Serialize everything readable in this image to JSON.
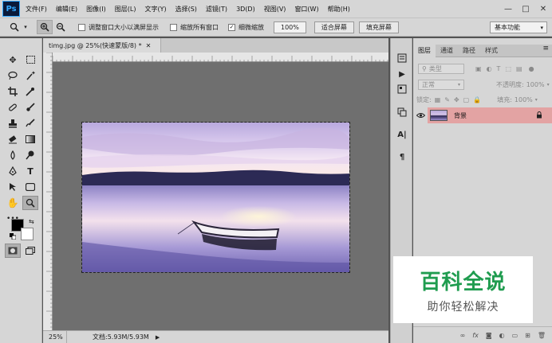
{
  "app": {
    "logo": "Ps",
    "menu": [
      "文件(F)",
      "编辑(E)",
      "图像(I)",
      "图层(L)",
      "文字(Y)",
      "选择(S)",
      "滤镜(T)",
      "3D(D)",
      "视图(V)",
      "窗口(W)",
      "帮助(H)"
    ],
    "window_controls": [
      "—",
      "□",
      "✕"
    ]
  },
  "options": {
    "check_resize": "调整窗口大小以满屏显示",
    "check_all_windows": "缩放所有窗口",
    "check_scrubby": "细微缩放",
    "zoom_value": "100%",
    "fit_button": "适合屏幕",
    "fill_button": "填充屏幕",
    "workspace": "基本功能"
  },
  "document": {
    "tab_title": "timg.jpg @ 25%(快速蒙版/8) *",
    "status_zoom": "25%",
    "status_doc": "文档:5.93M/5.93M"
  },
  "layers": {
    "tabs": [
      "图层",
      "通道",
      "路径",
      "样式"
    ],
    "kind_label": "类型",
    "blend_mode": "正常",
    "opacity_label": "不透明度:",
    "opacity_value": "100%",
    "lock_label": "锁定:",
    "fill_label": "填充:",
    "fill_value": "100%",
    "layer_name": "背景"
  },
  "watermark": {
    "main": "百科全说",
    "sub": "助你轻松解决"
  },
  "colors": {
    "selected_layer": "#e3a3a3",
    "watermark_green": "#1f9c4f"
  }
}
